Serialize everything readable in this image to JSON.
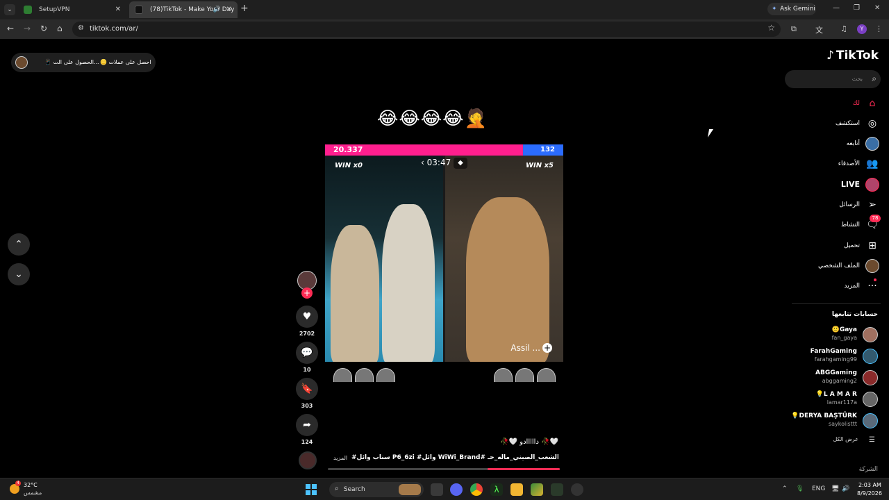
{
  "browser": {
    "tabs": [
      {
        "title": "SetupVPN",
        "active": false
      },
      {
        "title": "(78)TikTok - Make Your Day",
        "active": true
      }
    ],
    "new_tab": "+",
    "ask_gemini": "Ask Gemini",
    "url": "tiktok.com/ar/",
    "profile_initial": "Y",
    "icons": [
      "back-icon",
      "forward-icon",
      "reload-icon",
      "home-icon",
      "site-info-icon",
      "bookmark-star-icon",
      "extensions-icon",
      "translate-icon",
      "media-icon",
      "menu-icon"
    ]
  },
  "coins_bar": {
    "link1": "الحصول على الت...",
    "link2": "احصل على عملات"
  },
  "video": {
    "emoji_caption": "😂😂😂😂🤦",
    "score_left": "20.337",
    "score_right": "132",
    "score_left_share": 0.83,
    "timer": "03:47",
    "win_left": "WIN x0",
    "win_right": "WIN x5",
    "host_name": "Assil ...",
    "progress": 0.31
  },
  "actions": {
    "likes": "2702",
    "comments": "10",
    "saves": "303",
    "shares": "124"
  },
  "caption": {
    "title": "🥀🤍 دااااادو 🥀🤍",
    "tags": "#سناب وائل P6_6zi #وائل WiWi_Brand# ليكي #الشعب_الصيني_ماله_حـ...",
    "more": "المزيد"
  },
  "sidebar": {
    "logo": "TikTok",
    "search_placeholder": "بحث",
    "nav": [
      {
        "label": "لك",
        "icon": "home-icon"
      },
      {
        "label": "استكشف",
        "icon": "compass-icon"
      },
      {
        "label": "أتابعه",
        "icon": "following-avatar"
      },
      {
        "label": "الأصدقاء",
        "icon": "friends-icon"
      },
      {
        "label": "LIVE",
        "icon": "live-avatar"
      },
      {
        "label": "الرسائل",
        "icon": "messages-icon"
      },
      {
        "label": "النشاط",
        "icon": "activity-icon",
        "badge": "78"
      },
      {
        "label": "تحميل",
        "icon": "upload-icon"
      },
      {
        "label": "الملف الشخصي",
        "icon": "profile-avatar"
      },
      {
        "label": "المزيد",
        "icon": "more-icon"
      }
    ],
    "following_title": "حسابات تتابعها",
    "accounts": [
      {
        "name": "Gaya",
        "handle": "fan_gaya",
        "prefix": "🙂"
      },
      {
        "name": "FarahGaming",
        "handle": "farahgaming99",
        "prefix": ""
      },
      {
        "name": "ABGGaming",
        "handle": "abggaming2",
        "prefix": ""
      },
      {
        "name": "L A M A R",
        "handle": "lamar117a",
        "prefix": "💡"
      },
      {
        "name": "DERYA BAŞTÜRK",
        "handle": "saykolisttt",
        "prefix": "💡"
      }
    ],
    "see_all": "عرض الكل",
    "company": "الشركة"
  },
  "taskbar": {
    "temp": "32°C",
    "condition": "مشمس",
    "weather_badge": "4",
    "search": "Search",
    "lang": "ENG",
    "time": "2:03 AM",
    "date": "8/9/2026"
  }
}
